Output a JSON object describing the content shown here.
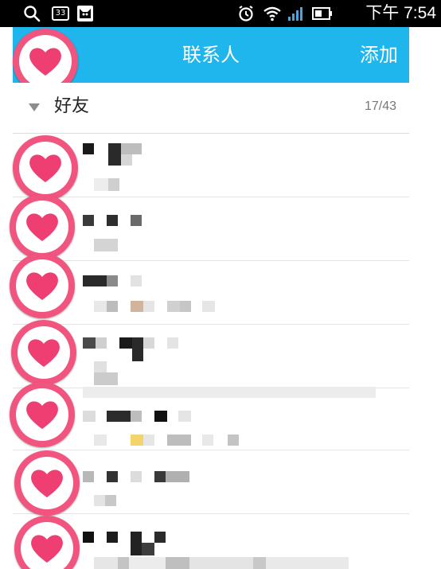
{
  "status_bar": {
    "notification_count": "33",
    "time_period": "下午",
    "time": "7:54",
    "icons": [
      "search-icon",
      "notification-count-icon",
      "cat-app-icon",
      "alarm-icon",
      "wifi-icon",
      "signal-icon",
      "battery-icon"
    ]
  },
  "header": {
    "title": "联系人",
    "add_label": "添加"
  },
  "group": {
    "name": "好友",
    "count": "17/43"
  },
  "colors": {
    "title_bar": "#1eb6ec",
    "avatar_ring": "#f1557f",
    "heart": "#ee3e72"
  },
  "contacts_visible": 7
}
